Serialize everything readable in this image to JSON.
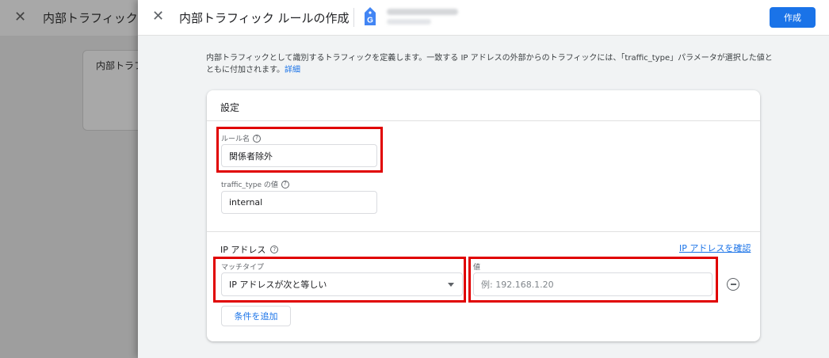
{
  "background": {
    "title": "内部トラフィックの",
    "card_text": "内部トラフィ"
  },
  "header": {
    "title": "内部トラフィック ルールの作成",
    "create_label": "作成",
    "ga_icon_letter": "G"
  },
  "description": {
    "text": "内部トラフィックとして識別するトラフィックを定義します。一致する IP アドレスの外部からのトラフィックには、「traffic_type」パラメータが選択した値とともに付加されます。",
    "link": "詳細"
  },
  "settings": {
    "title": "設定",
    "rule_name": {
      "label": "ルール名",
      "value": "関係者除外"
    },
    "traffic_type": {
      "label": "traffic_type の値",
      "value": "internal"
    }
  },
  "ip_section": {
    "title": "IP アドレス",
    "check_link": "IP アドレスを確認",
    "match_type": {
      "label": "マッチタイプ",
      "value": "IP アドレスが次と等しい"
    },
    "value_field": {
      "label": "値",
      "placeholder": "例: 192.168.1.20"
    },
    "add_condition": "条件を追加"
  },
  "help_glyph": "?",
  "colors": {
    "accent": "#1a73e8",
    "highlight": "#e00000"
  }
}
